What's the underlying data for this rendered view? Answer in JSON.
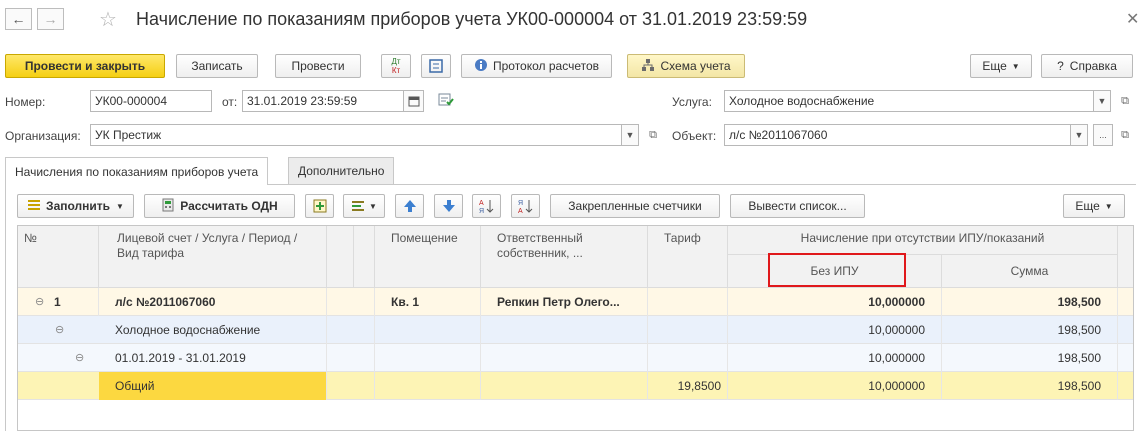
{
  "title": "Начисление по показаниям приборов учета УК00-000004 от 31.01.2019 23:59:59",
  "toolbar": {
    "post_close": "Провести и закрыть",
    "save": "Записать",
    "post": "Провести",
    "dt_kt_top": "Дт",
    "dt_kt_bottom": "Кт",
    "protocol": "Протокол расчетов",
    "scheme": "Схема учета",
    "more": "Еще",
    "help": "Справка",
    "help_glyph": "?"
  },
  "form": {
    "number_label": "Номер:",
    "number_value": "УК00-000004",
    "date_label": "от:",
    "date_value": "31.01.2019 23:59:59",
    "org_label": "Организация:",
    "org_value": "УК Престиж",
    "service_label": "Услуга:",
    "service_value": "Холодное водоснабжение",
    "object_label": "Объект:",
    "object_value": "л/с №2011067060",
    "ellipsis": "..."
  },
  "tabs": [
    {
      "label": "Начисления по показаниям приборов учета",
      "active": true
    },
    {
      "label": "Дополнительно",
      "active": false
    }
  ],
  "table_toolbar": {
    "fill": "Заполнить",
    "calc_odn": "Рассчитать ОДН",
    "fixed_meters": "Закрепленные счетчики",
    "output_list": "Вывести список...",
    "more": "Еще"
  },
  "table": {
    "headers": {
      "num": "№",
      "account": "Лицевой счет / Услуга / Период / Вид тарифа",
      "room": "Помещение",
      "owner": "Ответственный собственник, ...",
      "tariff": "Тариф",
      "group": "Начисление при отсутствии ИПУ/показаний",
      "no_ipu": "Без ИПУ",
      "sum": "Сумма"
    },
    "rows": [
      {
        "num": "1",
        "account": "л/с №2011067060",
        "room": "Кв. 1",
        "owner": "Репкин Петр Олего...",
        "tariff": "",
        "no_ipu": "10,000000",
        "sum": "198,500"
      },
      {
        "num": "",
        "account": "Холодное водоснабжение",
        "room": "",
        "owner": "",
        "tariff": "",
        "no_ipu": "10,000000",
        "sum": "198,500"
      },
      {
        "num": "",
        "account": "01.01.2019 - 31.01.2019",
        "room": "",
        "owner": "",
        "tariff": "",
        "no_ipu": "10,000000",
        "sum": "198,500"
      },
      {
        "num": "",
        "account": "Общий",
        "room": "",
        "owner": "",
        "tariff": "19,8500",
        "no_ipu": "10,000000",
        "sum": "198,500"
      }
    ]
  },
  "icons": {
    "back": "arrow-left-icon",
    "forward": "arrow-right-icon",
    "favorite": "star-icon",
    "close": "close-icon"
  },
  "colors": {
    "primary_button": "#f5cf13",
    "row_bold_bg": "#fff8e6",
    "row_blue_bg": "#eaf1fb",
    "row_light_bg": "#f4f8fd",
    "row_yellow_bg": "#fdf4b5",
    "selected_cell": "#fcd840",
    "highlight_border": "#e0181b"
  }
}
